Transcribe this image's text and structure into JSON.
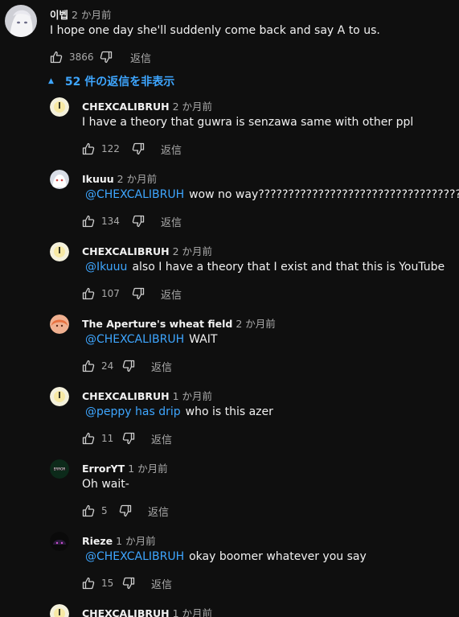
{
  "top_comment": {
    "author": "이벱",
    "time": "2 か月前",
    "text": "I hope one day she'll suddenly come back and say A to us.",
    "likes": "3866",
    "reply_label": "返信"
  },
  "replies_toggle": {
    "label": "52 件の返信を非表示"
  },
  "replies": [
    {
      "author": "CHEXCALIBRUH",
      "time": "2 か月前",
      "mention": "",
      "text": "I have a theory that guwra is senzawa same with other ppl",
      "likes": "122",
      "reply_label": "返信"
    },
    {
      "author": "Ikuuu",
      "time": "2 か月前",
      "mention": "@CHEXCALIBRUH",
      "text": "wow no way????????????????????????????????????????",
      "likes": "134",
      "reply_label": "返信"
    },
    {
      "author": "CHEXCALIBRUH",
      "time": "2 か月前",
      "mention": "@Ikuuu",
      "text": "also I have a theory that I exist and that this is YouTube",
      "likes": "107",
      "reply_label": "返信"
    },
    {
      "author": "The Aperture's wheat field",
      "time": "2 か月前",
      "mention": "@CHEXCALIBRUH",
      "text": "WAIT",
      "likes": "24",
      "reply_label": "返信"
    },
    {
      "author": "CHEXCALIBRUH",
      "time": "1 か月前",
      "mention": "@peppy has drip",
      "text": "who is this azer",
      "likes": "11",
      "reply_label": "返信"
    },
    {
      "author": "ErrorYT",
      "time": "1 か月前",
      "mention": "",
      "text": "Oh wait-",
      "likes": "5",
      "reply_label": "返信"
    },
    {
      "author": "Rieze",
      "time": "1 か月前",
      "mention": "@CHEXCALIBRUH",
      "text": "okay boomer whatever you say",
      "likes": "15",
      "reply_label": "返信"
    },
    {
      "author": "CHEXCALIBRUH",
      "time": "1 か月前",
      "mention": "",
      "text": "",
      "likes": "",
      "reply_label": ""
    }
  ],
  "colors": {
    "background": "#0f0f0f",
    "text": "#f1f1f1",
    "secondary": "#aaaaaa",
    "link": "#3ea6ff"
  }
}
